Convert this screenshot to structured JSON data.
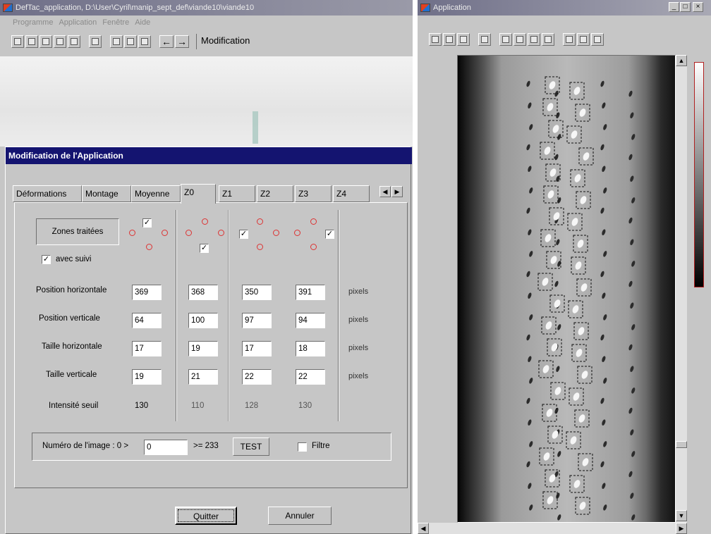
{
  "left_window": {
    "title": "DefTac_application, D:\\User\\Cyril\\manip_sept_def\\viande10\\viande10",
    "menu": [
      "Programme",
      "Application",
      "Fenêtre",
      "Aide"
    ],
    "mode_label": "Modification"
  },
  "dialog": {
    "title": "Modification de l'Application",
    "tabs": [
      "Déformations",
      "Montage",
      "Moyenne",
      "Z0",
      "Z1",
      "Z2",
      "Z3",
      "Z4"
    ],
    "active_tab": "Z0",
    "zones_label": "Zones traitées",
    "avec_suivi": {
      "label": "avec suivi",
      "checked": true
    },
    "rows": [
      {
        "label": "Position horizontale",
        "values": [
          "369",
          "368",
          "350",
          "391"
        ],
        "unit": "pixels"
      },
      {
        "label": "Position verticale",
        "values": [
          "64",
          "100",
          "97",
          "94"
        ],
        "unit": "pixels"
      },
      {
        "label": "Taille horizontale",
        "values": [
          "17",
          "19",
          "17",
          "18"
        ],
        "unit": "pixels"
      },
      {
        "label": "Taille verticale",
        "values": [
          "19",
          "21",
          "22",
          "22"
        ],
        "unit": "pixels"
      }
    ],
    "intensity": {
      "label": "Intensité seuil",
      "values": [
        "130",
        "110",
        "128",
        "130"
      ]
    },
    "image_number": {
      "label": "Numéro de l'image : 0 >",
      "value": "0",
      "max_label": ">= 233",
      "test_button": "TEST"
    },
    "filtre": {
      "label": "Filtre",
      "checked": false
    },
    "buttons": {
      "quit": "Quitter",
      "cancel": "Annuler"
    }
  },
  "right_window": {
    "title": "Application",
    "controls": [
      "_",
      "□",
      "×"
    ]
  },
  "colors": {
    "dialog_title_bg": "#141470",
    "window_bg": "#c6c6c6",
    "marker_circle": "#d33333"
  },
  "icons": {
    "nav_left": "left-arrow-icon",
    "nav_right": "right-arrow-icon"
  }
}
